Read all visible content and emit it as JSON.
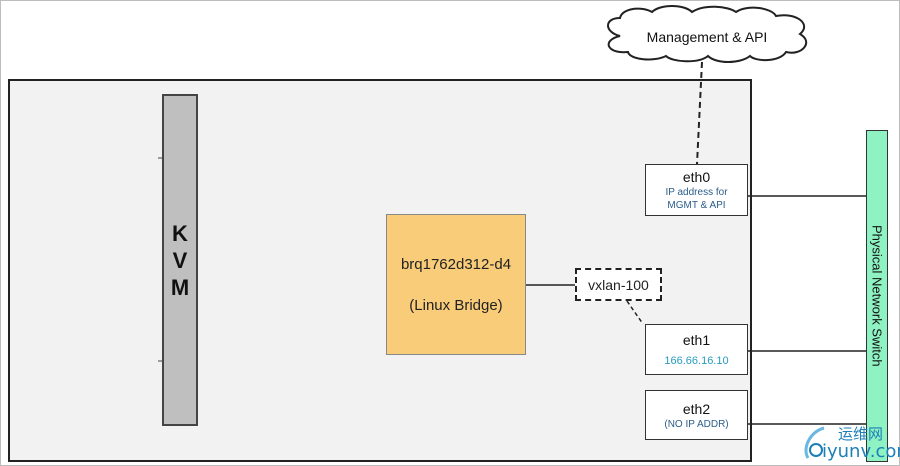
{
  "cloud": {
    "label": "Management & API"
  },
  "kvm": {
    "label": "KVM"
  },
  "bridge": {
    "name": "brq1762d312-d4",
    "type": "(Linux Bridge)"
  },
  "vxlan": {
    "label": "vxlan-100"
  },
  "nics": {
    "eth0": {
      "name": "eth0",
      "desc": "IP address for MGMT & API"
    },
    "eth1": {
      "name": "eth1",
      "ip": "166.66.16.10"
    },
    "eth2": {
      "name": "eth2",
      "desc": "(NO IP ADDR)"
    }
  },
  "switch": {
    "label": "Physical Network Switch"
  },
  "watermark": {
    "cn": "运维网",
    "en": "iyunv.com"
  },
  "colors": {
    "bridge": "#f8cc79",
    "kvm": "#bfbfbf",
    "switch": "#8ff2c2",
    "host": "#f2f2f2"
  }
}
